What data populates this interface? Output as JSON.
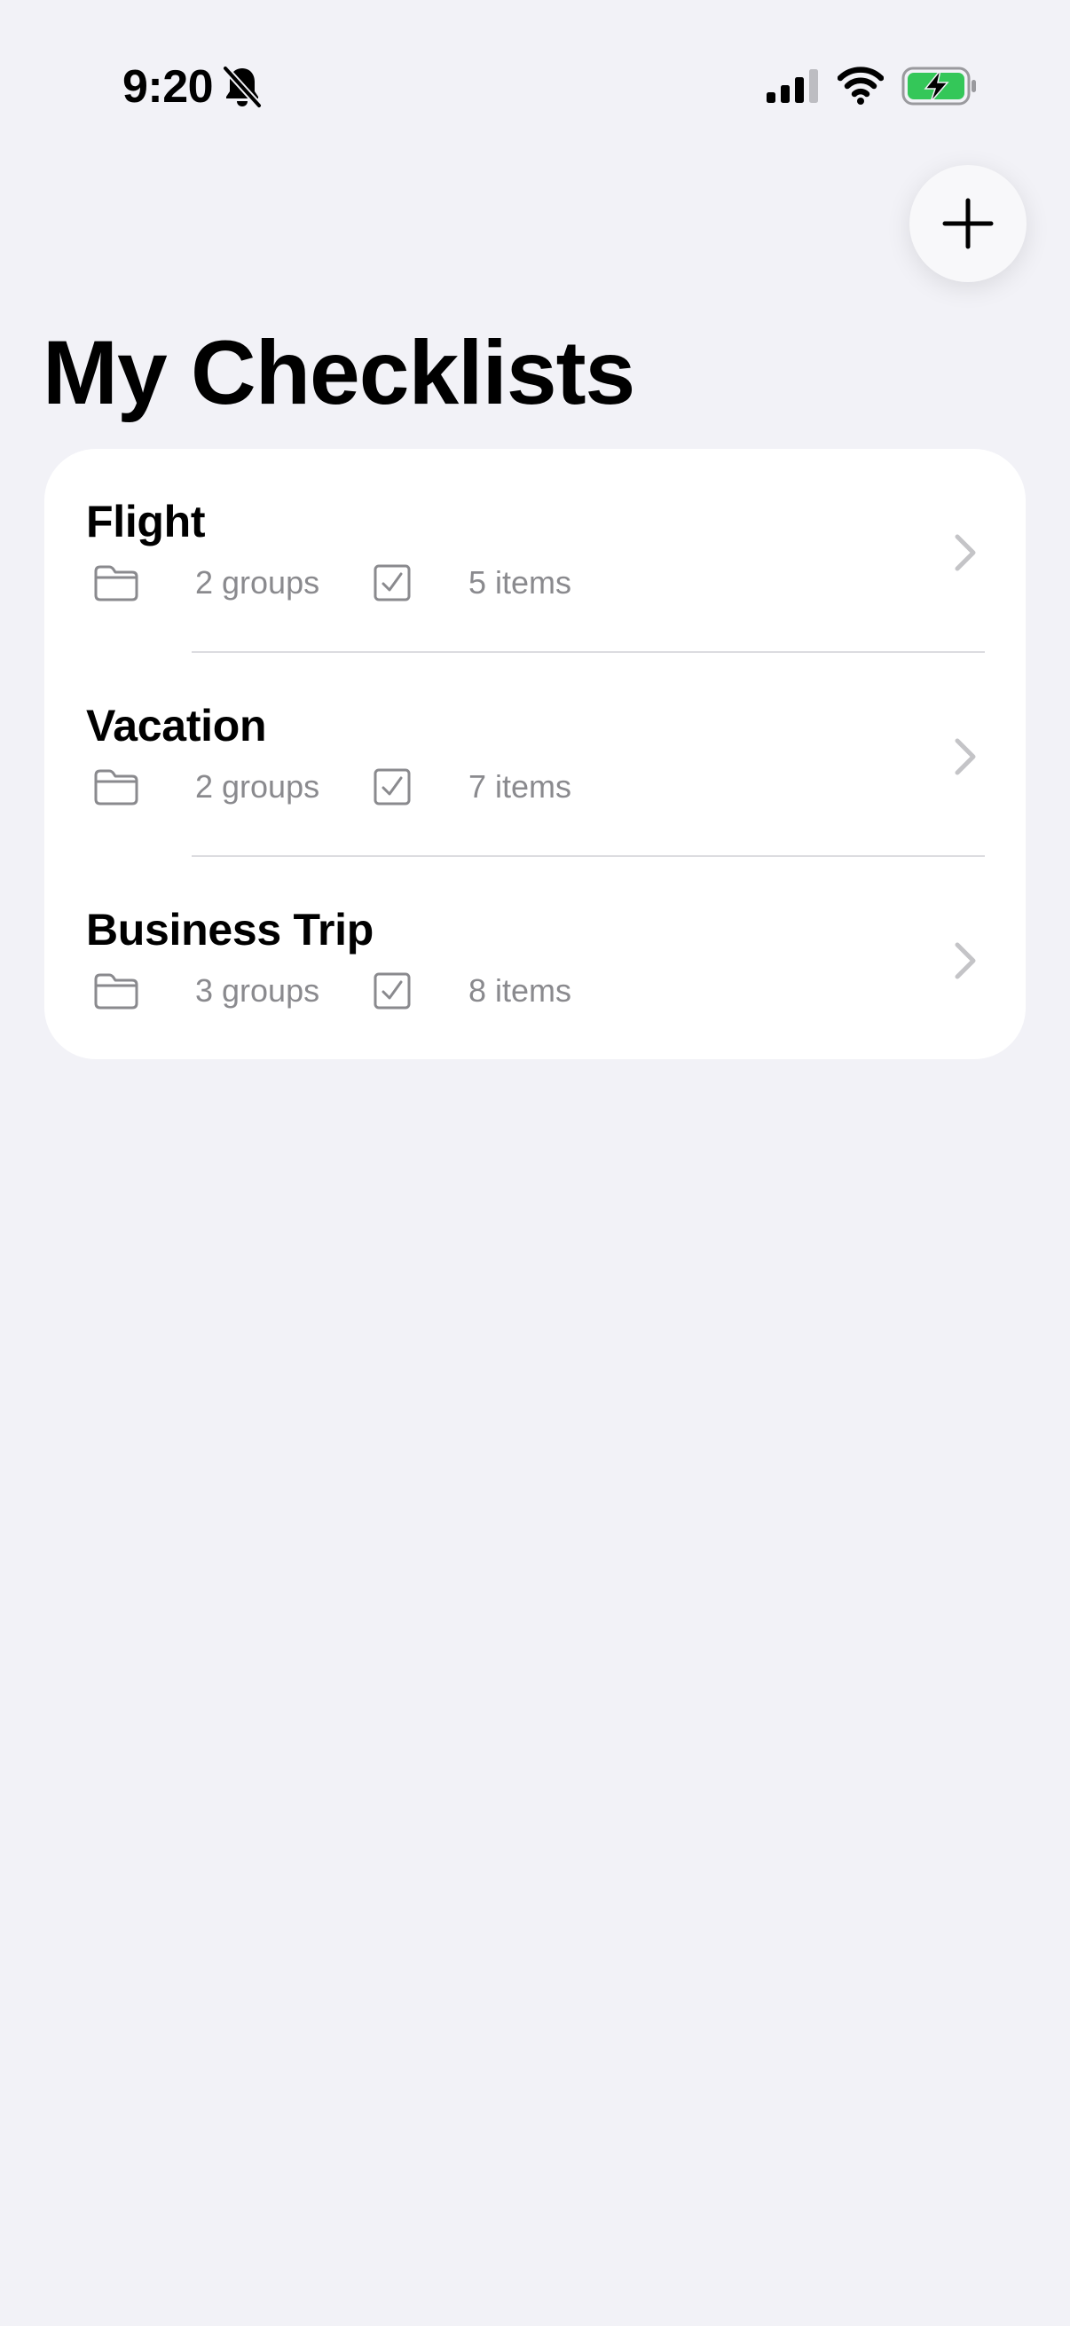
{
  "status_bar": {
    "time": "9:20",
    "icons": [
      "bell-slash-icon",
      "cellular-signal-icon",
      "wifi-icon",
      "battery-charging-icon"
    ],
    "battery_color": "#34C759"
  },
  "header": {
    "add_button_icon": "plus-icon",
    "title": "My Checklists"
  },
  "checklists": [
    {
      "name": "Flight",
      "groups": "2 groups",
      "items": "5 items"
    },
    {
      "name": "Vacation",
      "groups": "2 groups",
      "items": "7 items"
    },
    {
      "name": "Business Trip",
      "groups": "3 groups",
      "items": "8 items"
    }
  ],
  "colors": {
    "background": "#F2F2F7",
    "card": "#FFFFFF",
    "secondary_text": "#8A8A8E",
    "chevron": "#C4C4C7"
  }
}
